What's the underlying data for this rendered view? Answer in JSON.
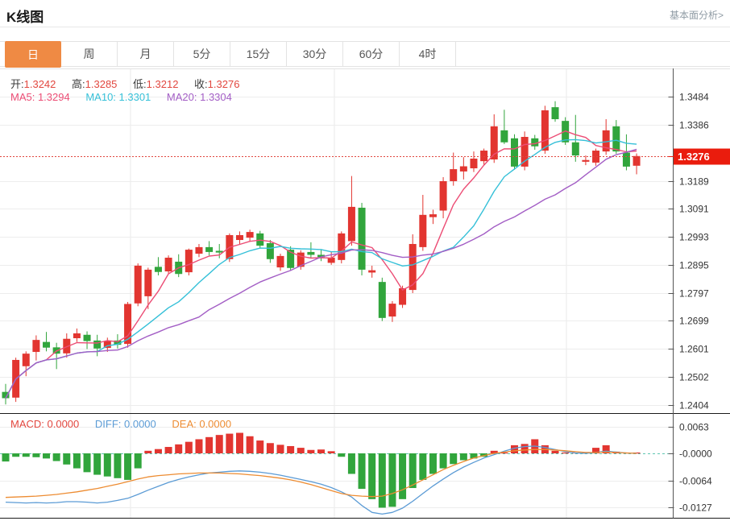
{
  "page": {
    "title": "K线图",
    "link": "基本面分析>"
  },
  "tabs": {
    "items": [
      "日",
      "周",
      "月",
      "5分",
      "15分",
      "30分",
      "60分",
      "4时"
    ],
    "selected": "日"
  },
  "quote_header": {
    "open_label": "开:",
    "open": "1.3242",
    "high_label": "高:",
    "high": "1.3285",
    "low_label": "低:",
    "low": "1.3212",
    "close_label": "收:",
    "close": "1.3276"
  },
  "ma_header": {
    "ma5": "MA5: 1.3294",
    "ma10": "MA10: 1.3301",
    "ma20": "MA20: 1.3304"
  },
  "macd_header": {
    "macd": "MACD: 0.0000",
    "diff": "DIFF: 0.0000",
    "dea": "DEA: 0.0000"
  },
  "price_axis": {
    "labels": [
      "1.3484",
      "1.3386",
      "1.3189",
      "1.3091",
      "1.2993",
      "1.2895",
      "1.2797",
      "1.2699",
      "1.2601",
      "1.2502",
      "1.2404"
    ],
    "badge": "1.3276"
  },
  "macd_axis": {
    "labels": [
      "0.0063",
      "-0.0000",
      "-0.0064",
      "-0.0127"
    ]
  },
  "colors": {
    "accent_orange": "#ef8a44",
    "up_red": "#e23530",
    "down_green": "#31a53c",
    "badge_red": "#ea1c0d",
    "dotted_line_red": "#e0463e",
    "ma5_pink": "#ec4d75",
    "ma10_cyan": "#35c0d8",
    "ma20_purple": "#a35ec5",
    "diff_blue": "#5b9bd5",
    "dea_orange": "#ed8c32",
    "zero_dash_teal": "#5fc6b2",
    "grid_gray": "#ededed",
    "axis_dark": "#444444",
    "value_red": "#e2473f"
  },
  "chart_data": {
    "type": "candlestick",
    "title": "K线图",
    "current_price": 1.3276,
    "price_range": {
      "top": 1.3484,
      "bottom": 1.2404
    },
    "macd_range": {
      "top": 0.0063,
      "bottom": -0.0127
    },
    "legend": [
      "MA5",
      "MA10",
      "MA20",
      "MACD",
      "DIFF",
      "DEA"
    ],
    "candles": [
      [
        1.245,
        1.2478,
        1.2406,
        1.2428
      ],
      [
        1.243,
        1.257,
        1.2415,
        1.2562
      ],
      [
        1.254,
        1.2592,
        1.2505,
        1.2584
      ],
      [
        1.259,
        1.2648,
        1.256,
        1.2632
      ],
      [
        1.2625,
        1.266,
        1.2592,
        1.2605
      ],
      [
        1.2606,
        1.2622,
        1.253,
        1.2584
      ],
      [
        1.2585,
        1.2655,
        1.257,
        1.2636
      ],
      [
        1.2638,
        1.2672,
        1.2625,
        1.2655
      ],
      [
        1.265,
        1.2662,
        1.26,
        1.2628
      ],
      [
        1.263,
        1.265,
        1.2575,
        1.2602
      ],
      [
        1.2604,
        1.264,
        1.259,
        1.2628
      ],
      [
        1.263,
        1.2652,
        1.2602,
        1.2615
      ],
      [
        1.2618,
        1.2765,
        1.2605,
        1.2758
      ],
      [
        1.276,
        1.29,
        1.275,
        1.2892
      ],
      [
        1.2785,
        1.2885,
        1.274,
        1.2878
      ],
      [
        1.2888,
        1.2922,
        1.2858,
        1.287
      ],
      [
        1.2872,
        1.2928,
        1.2862,
        1.292
      ],
      [
        1.2906,
        1.2932,
        1.2852,
        1.2863
      ],
      [
        1.2869,
        1.2952,
        1.2858,
        1.2948
      ],
      [
        1.2934,
        1.2968,
        1.2922,
        1.2957
      ],
      [
        1.2957,
        1.2978,
        1.2928,
        1.294
      ],
      [
        1.2944,
        1.2968,
        1.2918,
        1.2938
      ],
      [
        1.2915,
        1.3005,
        1.2905,
        1.2999
      ],
      [
        1.2982,
        1.3012,
        1.2968,
        1.2999
      ],
      [
        1.299,
        1.3018,
        1.2976,
        1.301
      ],
      [
        1.3005,
        1.3014,
        1.2952,
        1.2962
      ],
      [
        1.2971,
        1.2982,
        1.2902,
        1.2915
      ],
      [
        1.2886,
        1.2934,
        1.2874,
        1.2926
      ],
      [
        1.2948,
        1.296,
        1.2876,
        1.2884
      ],
      [
        1.2888,
        1.2946,
        1.2878,
        1.2938
      ],
      [
        1.294,
        1.2974,
        1.2918,
        1.293
      ],
      [
        1.293,
        1.295,
        1.2908,
        1.2922
      ],
      [
        1.2902,
        1.2942,
        1.2895,
        1.292
      ],
      [
        1.2912,
        1.3012,
        1.29,
        1.3005
      ],
      [
        1.2978,
        1.3206,
        1.2962,
        1.3098
      ],
      [
        1.3095,
        1.3112,
        1.2858,
        1.2878
      ],
      [
        1.2868,
        1.2892,
        1.285,
        1.2876
      ],
      [
        1.2835,
        1.285,
        1.2698,
        1.2709
      ],
      [
        1.2714,
        1.2768,
        1.2695,
        1.2759
      ],
      [
        1.2755,
        1.2822,
        1.2744,
        1.2813
      ],
      [
        1.2807,
        1.3002,
        1.2796,
        1.2968
      ],
      [
        1.2957,
        1.314,
        1.2944,
        1.307
      ],
      [
        1.3062,
        1.3088,
        1.3038,
        1.3072
      ],
      [
        1.3085,
        1.3202,
        1.3058,
        1.3188
      ],
      [
        1.3188,
        1.3288,
        1.3172,
        1.323
      ],
      [
        1.3222,
        1.3272,
        1.3194,
        1.324
      ],
      [
        1.3233,
        1.3292,
        1.322,
        1.3267
      ],
      [
        1.3258,
        1.3302,
        1.3246,
        1.3295
      ],
      [
        1.3264,
        1.3422,
        1.3252,
        1.338
      ],
      [
        1.3366,
        1.3438,
        1.3318,
        1.3324
      ],
      [
        1.3338,
        1.3352,
        1.3228,
        1.3239
      ],
      [
        1.3239,
        1.3362,
        1.3226,
        1.3343
      ],
      [
        1.3338,
        1.335,
        1.3298,
        1.331
      ],
      [
        1.3295,
        1.3452,
        1.3284,
        1.3436
      ],
      [
        1.3447,
        1.3468,
        1.3396,
        1.3405
      ],
      [
        1.3399,
        1.3412,
        1.3315,
        1.3324
      ],
      [
        1.3324,
        1.342,
        1.3256,
        1.3278
      ],
      [
        1.3256,
        1.3278,
        1.3244,
        1.3262
      ],
      [
        1.3253,
        1.3302,
        1.3242,
        1.3295
      ],
      [
        1.3292,
        1.3405,
        1.328,
        1.3366
      ],
      [
        1.338,
        1.3402,
        1.3284,
        1.3292
      ],
      [
        1.3288,
        1.3352,
        1.3226,
        1.3239
      ],
      [
        1.3242,
        1.3285,
        1.3212,
        1.3276
      ]
    ],
    "ma_windows": [
      5,
      10,
      20
    ],
    "macd": {
      "hist": [
        -0.0019,
        -0.0008,
        -0.0008,
        -0.0009,
        -0.0012,
        -0.0018,
        -0.0026,
        -0.0035,
        -0.0044,
        -0.005,
        -0.0054,
        -0.0058,
        -0.0062,
        -0.0035,
        0.0006,
        0.001,
        0.0015,
        0.0021,
        0.0027,
        0.0033,
        0.0038,
        0.0043,
        0.0046,
        0.0048,
        0.004,
        0.003,
        0.0024,
        0.002,
        0.0017,
        0.0013,
        0.0008,
        0.0009,
        0.0005,
        -0.0008,
        -0.0048,
        -0.0083,
        -0.0107,
        -0.0127,
        -0.0125,
        -0.0107,
        -0.0081,
        -0.0062,
        -0.0048,
        -0.0035,
        -0.0025,
        -0.0016,
        -0.0012,
        -0.0008,
        0.0006,
        0.0002,
        0.0019,
        0.0022,
        0.0033,
        0.0019,
        0.0006,
        0.0002,
        0.0002,
        0.0003,
        0.0013,
        0.0019,
        0.0004,
        0.0002,
        0.0002
      ],
      "diff": [
        -0.0114,
        -0.0115,
        -0.0116,
        -0.0115,
        -0.0116,
        -0.0115,
        -0.0113,
        -0.0113,
        -0.0114,
        -0.0116,
        -0.0114,
        -0.011,
        -0.0105,
        -0.0096,
        -0.0086,
        -0.0077,
        -0.0068,
        -0.0061,
        -0.0055,
        -0.005,
        -0.0046,
        -0.0044,
        -0.0042,
        -0.0041,
        -0.0042,
        -0.0044,
        -0.0047,
        -0.0051,
        -0.0056,
        -0.0061,
        -0.0066,
        -0.0072,
        -0.008,
        -0.009,
        -0.0102,
        -0.0122,
        -0.0138,
        -0.0142,
        -0.0138,
        -0.0128,
        -0.0112,
        -0.0094,
        -0.0076,
        -0.006,
        -0.0045,
        -0.0032,
        -0.0021,
        -0.0011,
        -0.0003,
        0.0005,
        0.0012,
        0.0016,
        0.0017,
        0.0014,
        0.0009,
        0.0004,
        0.0001,
        0.0,
        0.0002,
        0.0005,
        0.0003,
        0.0001,
        0.0
      ],
      "dea": [
        -0.0103,
        -0.0102,
        -0.0101,
        -0.01,
        -0.0098,
        -0.0096,
        -0.0093,
        -0.009,
        -0.0086,
        -0.0082,
        -0.0077,
        -0.0072,
        -0.0066,
        -0.006,
        -0.0055,
        -0.0052,
        -0.005,
        -0.0048,
        -0.0047,
        -0.0046,
        -0.0046,
        -0.0046,
        -0.0047,
        -0.0048,
        -0.005,
        -0.0052,
        -0.0055,
        -0.0058,
        -0.0062,
        -0.0067,
        -0.0073,
        -0.008,
        -0.0087,
        -0.0094,
        -0.0098,
        -0.01,
        -0.0101,
        -0.01,
        -0.0094,
        -0.0085,
        -0.0074,
        -0.0062,
        -0.005,
        -0.0038,
        -0.0028,
        -0.0019,
        -0.0011,
        -0.0005,
        0.0,
        0.0003,
        0.0006,
        0.0008,
        0.0009,
        0.0009,
        0.0008,
        0.0006,
        0.0004,
        0.0002,
        0.0002,
        0.0003,
        0.0002,
        0.0001,
        0.0
      ]
    }
  }
}
